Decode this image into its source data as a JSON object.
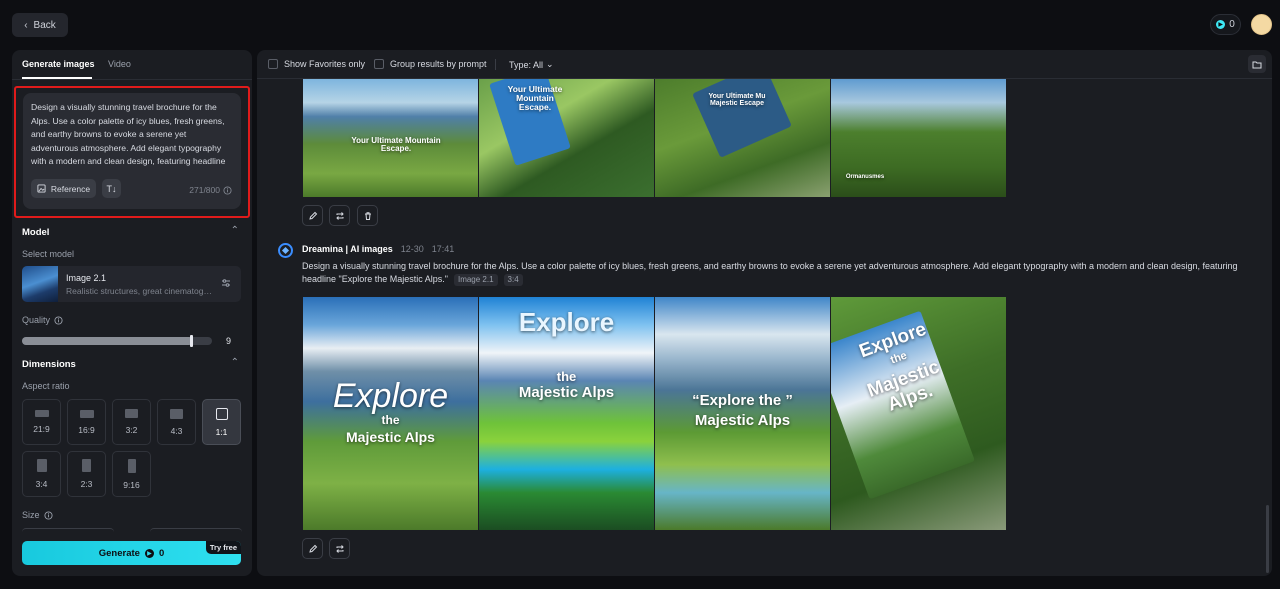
{
  "topbar": {
    "back_label": "Back",
    "credits": "0"
  },
  "left_panel": {
    "tabs": [
      "Generate images",
      "Video"
    ],
    "prompt": {
      "text": "Design a visually stunning travel brochure for the Alps. Use a color palette of icy blues, fresh greens, and earthy browns to evoke a serene yet adventurous atmosphere. Add elegant typography with a modern and clean design, featuring headline \"Explore the Majestic Alps.\"",
      "reference_label": "Reference",
      "char_count": "271/800"
    },
    "model_section": {
      "title": "Model",
      "select_label": "Select model",
      "model_name": "Image 2.1",
      "model_desc": "Realistic structures, great cinematography"
    },
    "quality": {
      "label": "Quality",
      "value": "9",
      "fraction": 0.9
    },
    "dimensions": {
      "title": "Dimensions",
      "aspect_label": "Aspect ratio",
      "ratios": [
        "21:9",
        "16:9",
        "3:2",
        "4:3",
        "1:1",
        "3:4",
        "2:3",
        "9:16"
      ],
      "selected": "1:1"
    },
    "size_label": "Size",
    "generate": {
      "label": "Generate",
      "cost": "0",
      "badge": "Try free"
    }
  },
  "right_panel": {
    "filters": {
      "favorites": "Show Favorites only",
      "group": "Group results by prompt",
      "type": "Type: All"
    },
    "first_group_captions": [
      "Your Ultimate Mountain Escape.",
      "Your Ultimate Mountain Escape.",
      "Your Ultimate Mu Majestic Escape",
      "Ormanusmes"
    ],
    "second_group": {
      "source": "Dreamina | AI images",
      "date": "12-30",
      "time": "17:41",
      "prompt": "Design a visually stunning travel brochure for the Alps. Use a color palette of icy blues, fresh greens, and earthy browns to evoke a serene yet adventurous atmosphere. Add elegant typography with a modern and clean design, featuring headline \"Explore the Majestic Alps.\"",
      "tags": [
        "Image 2.1",
        "3:4"
      ],
      "captions": [
        {
          "top": "Explore",
          "mid": "the",
          "bottom": "Majestic Alps"
        },
        {
          "top": "Explore",
          "mid": "the",
          "bottom": "Majestic Alps"
        },
        {
          "top": "“Explore the ”",
          "mid": "",
          "bottom": "Majestic Alps"
        },
        {
          "top": "Explore",
          "mid": "the",
          "bottom": "Majestic Alps."
        }
      ]
    }
  },
  "colors": {
    "accent": "#2fe0f0",
    "highlight": "#e01b1b",
    "panel": "#1b1d22",
    "background": "#0d0e12"
  }
}
